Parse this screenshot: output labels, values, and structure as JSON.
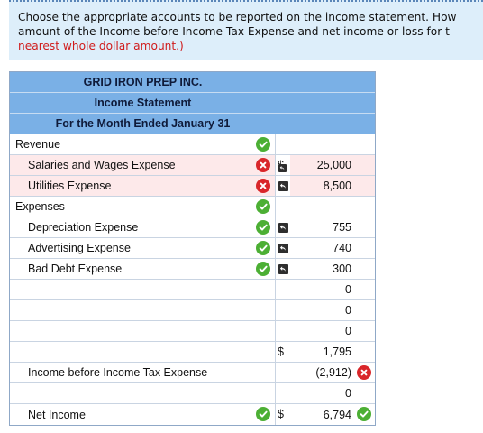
{
  "instructions": {
    "line1": "Choose the appropriate accounts to be reported on the income statement. How",
    "line2": "amount of the Income before Income Tax Expense and net income or loss for t",
    "line3": "nearest whole dollar amount.)"
  },
  "statement": {
    "company": "GRID IRON PREP INC.",
    "title": "Income Statement",
    "period": "For the Month Ended January 31"
  },
  "rows": [
    {
      "label": "Revenue",
      "indent": false,
      "mark": "ok",
      "dollar": "",
      "value": "",
      "value_mark": "",
      "pink": false,
      "undo": false
    },
    {
      "label": "Salaries and Wages Expense",
      "indent": true,
      "mark": "bad",
      "dollar": "$",
      "value": "25,000",
      "value_mark": "",
      "pink": true,
      "undo": true
    },
    {
      "label": "Utilities Expense",
      "indent": true,
      "mark": "bad",
      "dollar": "",
      "value": "8,500",
      "value_mark": "",
      "pink": true,
      "undo": true
    },
    {
      "label": "Expenses",
      "indent": false,
      "mark": "ok",
      "dollar": "",
      "value": "",
      "value_mark": "",
      "pink": false,
      "undo": false
    },
    {
      "label": "Depreciation Expense",
      "indent": true,
      "mark": "ok",
      "dollar": "",
      "value": "755",
      "value_mark": "",
      "pink": false,
      "undo": true
    },
    {
      "label": "Advertising Expense",
      "indent": true,
      "mark": "ok",
      "dollar": "",
      "value": "740",
      "value_mark": "",
      "pink": false,
      "undo": true
    },
    {
      "label": "Bad Debt Expense",
      "indent": true,
      "mark": "ok",
      "dollar": "",
      "value": "300",
      "value_mark": "",
      "pink": false,
      "undo": true
    },
    {
      "label": "",
      "indent": true,
      "mark": "",
      "dollar": "",
      "value": "0",
      "value_mark": "",
      "pink": false,
      "undo": false
    },
    {
      "label": "",
      "indent": true,
      "mark": "",
      "dollar": "",
      "value": "0",
      "value_mark": "",
      "pink": false,
      "undo": false
    },
    {
      "label": "",
      "indent": true,
      "mark": "",
      "dollar": "",
      "value": "0",
      "value_mark": "",
      "pink": false,
      "undo": false
    },
    {
      "label": "",
      "indent": true,
      "mark": "",
      "dollar": "$",
      "value": "1,795",
      "value_mark": "",
      "pink": false,
      "undo": false
    },
    {
      "label": "Income before Income Tax Expense",
      "indent": true,
      "mark": "",
      "dollar": "",
      "value": "(2,912)",
      "value_mark": "bad",
      "pink": false,
      "undo": false
    },
    {
      "label": "",
      "indent": true,
      "mark": "",
      "dollar": "",
      "value": "0",
      "value_mark": "",
      "pink": false,
      "undo": false
    },
    {
      "label": "Net Income",
      "indent": true,
      "mark": "ok",
      "dollar": "$",
      "value": "6,794",
      "value_mark": "ok",
      "pink": false,
      "undo": false
    }
  ],
  "icons": {
    "correct": "check-icon",
    "incorrect": "x-icon",
    "undo": "undo-arrow-icon"
  },
  "colors": {
    "header_bg": "#7ab0e6",
    "instructions_bg": "#ddeefa",
    "correct": "#4caf34",
    "incorrect": "#d9262a",
    "incorrect_row_bg": "#fde9ea",
    "highlight_text": "#d01c1c"
  }
}
